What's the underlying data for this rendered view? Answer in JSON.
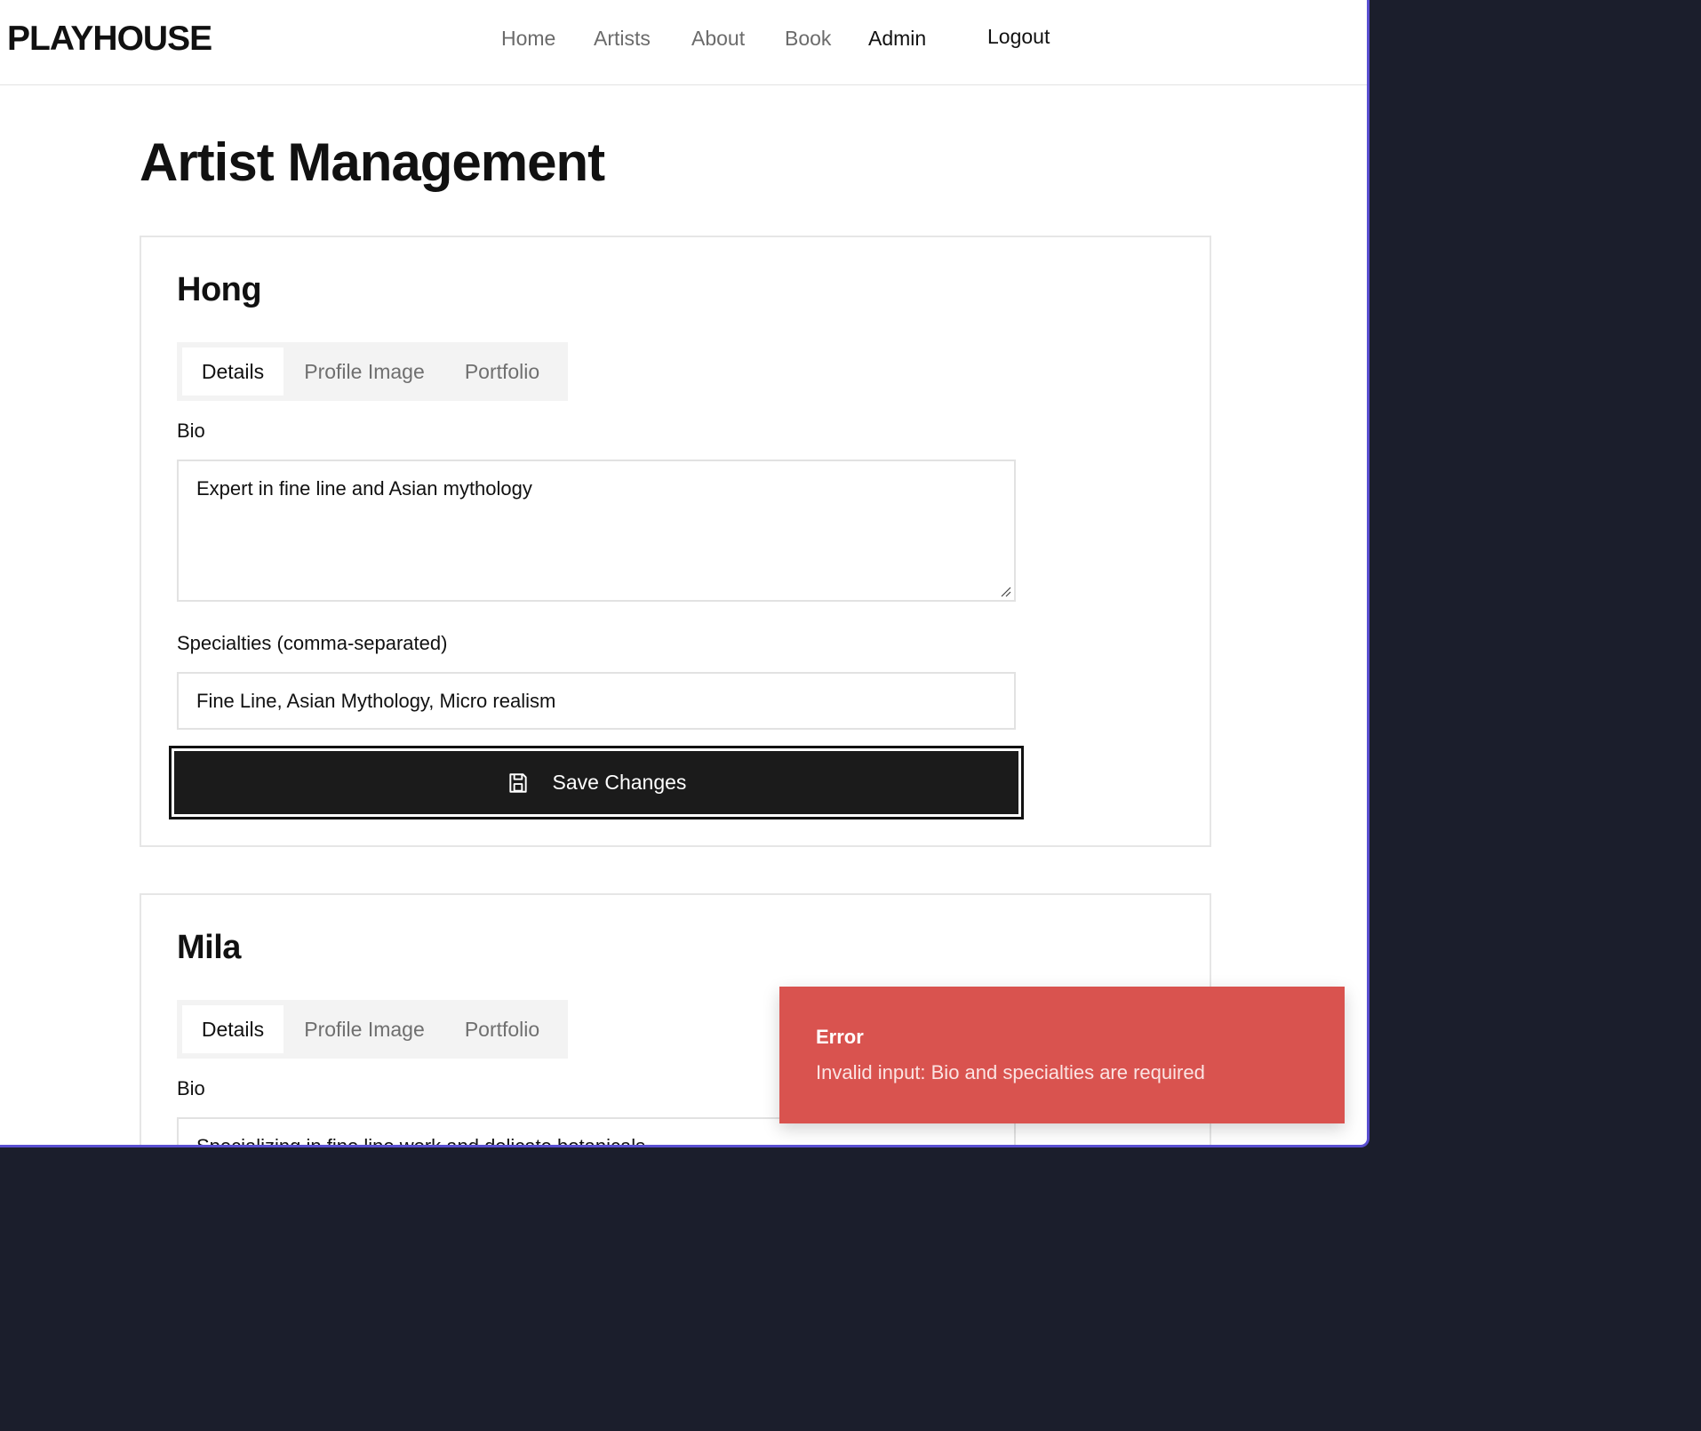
{
  "nav": {
    "brand": "PLAYHOUSE",
    "links": [
      {
        "label": "Home"
      },
      {
        "label": "Artists"
      },
      {
        "label": "About"
      },
      {
        "label": "Book"
      },
      {
        "label": "Admin",
        "active": true
      }
    ],
    "logout_label": "Logout"
  },
  "page": {
    "title": "Artist Management"
  },
  "artists": [
    {
      "name": "Hong",
      "tabs": [
        "Details",
        "Profile Image",
        "Portfolio"
      ],
      "active_tab": "Details",
      "bio_label": "Bio",
      "bio": "Expert in fine line and Asian mythology",
      "specialties_label": "Specialties (comma-separated)",
      "specialties": "Fine Line, Asian Mythology, Micro realism",
      "save_label": "Save Changes",
      "save_icon": "save-icon"
    },
    {
      "name": "Mila",
      "tabs": [
        "Details",
        "Profile Image",
        "Portfolio"
      ],
      "active_tab": "Details",
      "bio_label": "Bio",
      "bio": "Specializing in fine line work and delicate botanicals"
    }
  ],
  "toast": {
    "title": "Error",
    "message": "Invalid input: Bio and specialties are required",
    "color": "#d9534f"
  },
  "colors": {
    "primary_button": "#1b1b1b",
    "window_border": "#5a4fd1"
  }
}
